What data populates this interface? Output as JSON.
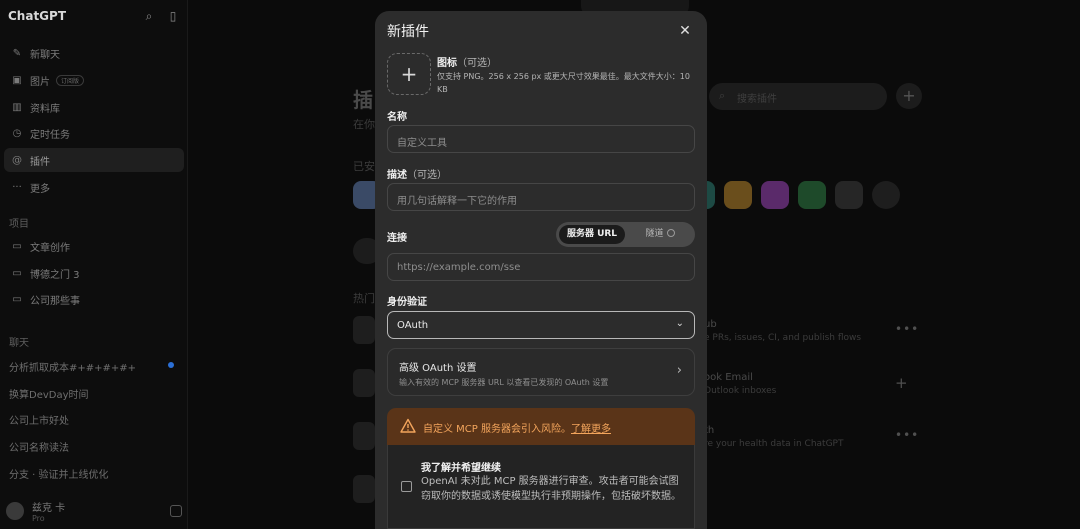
{
  "sidebar": {
    "brand": "ChatGPT",
    "nav": [
      {
        "label": "新聊天",
        "icon": "new-chat-icon"
      },
      {
        "label": "图片",
        "icon": "image-icon",
        "badge": "订阅版"
      },
      {
        "label": "资料库",
        "icon": "library-icon"
      },
      {
        "label": "定时任务",
        "icon": "clock-icon"
      },
      {
        "label": "插件",
        "icon": "plugin-icon"
      },
      {
        "label": "更多",
        "icon": "more-icon"
      }
    ],
    "projects_heading": "项目",
    "projects": [
      "文章创作",
      "博德之门 3",
      "公司那些事"
    ],
    "chats_heading": "聊天",
    "chats": [
      "分析抓取成本#+#+#+#+",
      "换算DevDay时间",
      "公司上市好处",
      "公司名称读法",
      "分支 · 验证并上线优化"
    ],
    "user": {
      "name": "兹克 卡",
      "plan": "Pro"
    }
  },
  "background": {
    "title": "插",
    "subtitle": "在你",
    "installed_heading": "已安",
    "hot_heading": "热门",
    "search_placeholder": "搜索插件",
    "rows": [
      {
        "title": "ub",
        "desc": "e PRs, issues, CI, and publish flows"
      },
      {
        "title": "ook Email",
        "desc": "Outlook inboxes"
      },
      {
        "title": "th",
        "desc": "re your health data in ChatGPT"
      }
    ]
  },
  "modal": {
    "title": "新插件",
    "icon_label": "图标",
    "icon_optional": "（可选）",
    "icon_desc": "仅支持 PNG。256 x 256 px 或更大尺寸效果最佳。最大文件大小：10 KB",
    "name_label": "名称",
    "name_placeholder": "自定义工具",
    "desc_label": "描述",
    "desc_optional": "（可选）",
    "desc_placeholder": "用几句话解释一下它的作用",
    "connect_label": "连接",
    "toggle_on": "服务器 URL",
    "toggle_off": "隧道",
    "url_placeholder": "https://example.com/sse",
    "auth_label": "身份验证",
    "auth_value": "OAuth",
    "adv_title": "高级 OAuth 设置",
    "adv_desc": "输入有效的 MCP 服务器 URL 以查看已发现的 OAuth 设置",
    "warning_text": "自定义 MCP 服务器会引入风险。",
    "warning_link": "了解更多",
    "ack_title": "我了解并希望继续",
    "ack_desc": "OpenAI 未对此 MCP 服务器进行审查。攻击者可能会试图窃取你的数据或诱使模型执行非预期操作，包括破坏数据。"
  },
  "colors": {
    "modal_bg": "#2c2c2c",
    "warning_bg": "#5a3418",
    "warning_text": "#f3a55c"
  }
}
